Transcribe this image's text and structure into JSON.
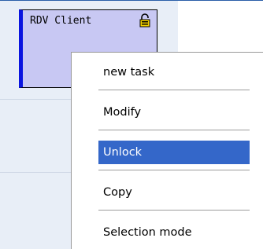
{
  "appointment": {
    "title": "RDV Client",
    "icon": "lock-icon",
    "fill_color": "#c8c8f3",
    "accent_color": "#0a14e0"
  },
  "context_menu": {
    "items": [
      {
        "label": "new task",
        "highlighted": false
      },
      {
        "label": "Modify",
        "highlighted": false
      },
      {
        "label": "Unlock",
        "highlighted": true
      },
      {
        "label": "Copy",
        "highlighted": false
      },
      {
        "label": "Selection mode",
        "highlighted": false
      }
    ],
    "highlight_color": "#3467c9"
  }
}
